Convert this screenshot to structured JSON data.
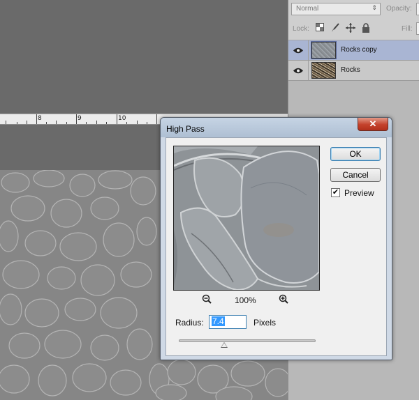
{
  "layers_panel": {
    "blend_mode": "Normal",
    "opacity_label": "Opacity:",
    "lock_label": "Lock:",
    "fill_label": "Fill:",
    "layers": [
      {
        "name": "Rocks copy",
        "selected": true,
        "visible": true
      },
      {
        "name": "Rocks",
        "selected": false,
        "visible": true
      }
    ]
  },
  "ruler": {
    "labels": [
      "8",
      "9",
      "10"
    ]
  },
  "dialog": {
    "title": "High Pass",
    "close_icon": "close-icon",
    "ok_label": "OK",
    "cancel_label": "Cancel",
    "preview_label": "Preview",
    "preview_checked": true,
    "zoom_level": "100%",
    "radius_label": "Radius:",
    "radius_value": "7.4",
    "radius_units": "Pixels",
    "radius_slider_fraction": 0.33
  },
  "colors": {
    "selected_layer": "#a9b5d3",
    "close_button": "#c3412b",
    "focus_accent": "#3c7fb1",
    "text_selection": "#3399ff"
  }
}
